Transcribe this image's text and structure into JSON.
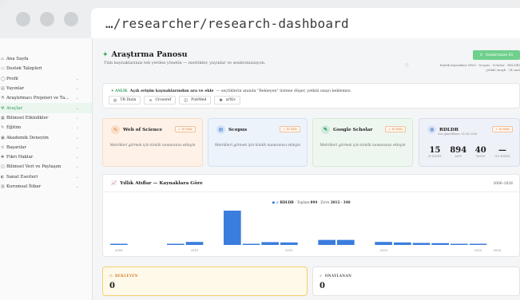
{
  "browser": {
    "url": "…/researcher/research-dashboard"
  },
  "sidebar": {
    "items": [
      {
        "label": "Ana Sayfa",
        "icon": "house-icon",
        "chevron": false,
        "active": false
      },
      {
        "label": "Destek Talepleri",
        "icon": "ticket-icon",
        "chevron": false,
        "active": false
      },
      {
        "label": "Profil",
        "icon": "user-icon",
        "chevron": true,
        "active": false
      },
      {
        "label": "Yayınlar",
        "icon": "book-icon",
        "chevron": true,
        "active": false
      },
      {
        "label": "Araştırmacı Projeleri ve Ta…",
        "icon": "flask-icon",
        "chevron": true,
        "active": false
      },
      {
        "label": "Araçlar",
        "icon": "tools-icon",
        "chevron": true,
        "active": true
      },
      {
        "label": "Bilimsel Etkinlikler",
        "icon": "calendar-icon",
        "chevron": true,
        "active": false
      },
      {
        "label": "Eğitim",
        "icon": "graduation-icon",
        "chevron": true,
        "active": false
      },
      {
        "label": "Akademik Deneyim",
        "icon": "briefcase-icon",
        "chevron": true,
        "active": false
      },
      {
        "label": "Başarılar",
        "icon": "trophy-icon",
        "chevron": true,
        "active": false
      },
      {
        "label": "Fikri Haklar",
        "icon": "bulb-icon",
        "chevron": true,
        "active": false
      },
      {
        "label": "Bilimsel Veri ve Paylaşım",
        "icon": "database-icon",
        "chevron": true,
        "active": false
      },
      {
        "label": "Sanat Eserleri",
        "icon": "palette-icon",
        "chevron": true,
        "active": false
      },
      {
        "label": "Kurumsal İtibar",
        "icon": "building-icon",
        "chevron": true,
        "active": false
      }
    ]
  },
  "header": {
    "title": "Araştırma Panosu",
    "subtitle": "Tüm kaynaklarınızı tek yerden yönetin — metrikler, yayınlar ve senkronizasyon.",
    "sync_button": "Senkronize Et",
    "sync_note_line1": "Kimlik kaynakları (WoS · Scopus · Scholar · RDLDB)",
    "sync_note_line2": "yetkili onaylı · 24 saat"
  },
  "search": {
    "new_badge": "ANLIK",
    "heading_bold": "Açık erişim kaynaklarından ara ve ekle",
    "heading_rest": "— seçtiklerin anında \"Bekleyen\" listene düşer, yetkili onayı beklemez.",
    "buttons": [
      {
        "label": "TR Dizin",
        "icon": "target-icon"
      },
      {
        "label": "Crossref",
        "icon": "link-icon"
      },
      {
        "label": "PubMed",
        "icon": "book-open-icon"
      },
      {
        "label": "arXiv",
        "icon": "sparkle-icon"
      }
    ]
  },
  "providers": [
    {
      "name": "Web of Science",
      "badge": "⚠ ID Ekle",
      "message": "Metrikleri görmek için kimlik numaranızı ekleyin",
      "icon": "pulse-icon",
      "icon_color": "#e0863e"
    },
    {
      "name": "Scopus",
      "badge": "⚠ ID Ekle",
      "message": "Metrikleri görmek için kimlik numaranızı ekleyin",
      "icon": "file-icon",
      "icon_color": "#3b7ddd"
    },
    {
      "name": "Google Scholar",
      "badge": "⚠ ID Ekle",
      "message": "Metrikleri görmek için kimlik numaranızı ekleyin",
      "icon": "graduation-icon",
      "icon_color": "#2f9a5a"
    }
  ],
  "rdldb": {
    "name": "RDLDB",
    "badge": "⚠ ID Ekle",
    "subtitle": "Son güncelleme: 01.06.2026",
    "stats": [
      {
        "value": "15",
        "label": "H-INDEX"
      },
      {
        "value": "894",
        "label": "ATIF"
      },
      {
        "value": "40",
        "label": "YAYIN"
      },
      {
        "value": "—",
        "label": "I10-INDEX"
      }
    ]
  },
  "chart_card": {
    "title": "Yıllık Atıflar — Kaynaklara Göre",
    "range": "2006–2026",
    "legend_source": "RDLDB",
    "legend_total_label": "· Toplam",
    "legend_total_value": "894",
    "legend_peak_label": "· Zirve",
    "legend_peak_value": "2012 · 340"
  },
  "chart_data": {
    "type": "bar",
    "series": [
      {
        "name": "RDLDB",
        "color": "#3b7ddd"
      }
    ],
    "categories": [
      "2006",
      "2007",
      "2008",
      "2009",
      "2010",
      "2011",
      "2012",
      "2013",
      "2014",
      "2015",
      "2016",
      "2017",
      "2018",
      "2019",
      "2020",
      "2021",
      "2022",
      "2023",
      "2024",
      "2025",
      "2026"
    ],
    "values": [
      12,
      0,
      0,
      10,
      30,
      0,
      340,
      8,
      28,
      25,
      0,
      50,
      50,
      0,
      30,
      25,
      20,
      18,
      10,
      5,
      0
    ],
    "tick_labels": [
      "2006",
      "2010",
      "2015",
      "2020",
      "2025",
      "2026"
    ],
    "xlabel": "",
    "ylabel": ""
  },
  "status": {
    "pending_label": "BEKLEYEN",
    "pending_value": "0",
    "approved_label": "ONAYLANAN",
    "approved_value": "0"
  },
  "colors": {
    "accent": "#2f9a5a",
    "bar": "#3b7ddd",
    "warning": "#e0863e"
  }
}
